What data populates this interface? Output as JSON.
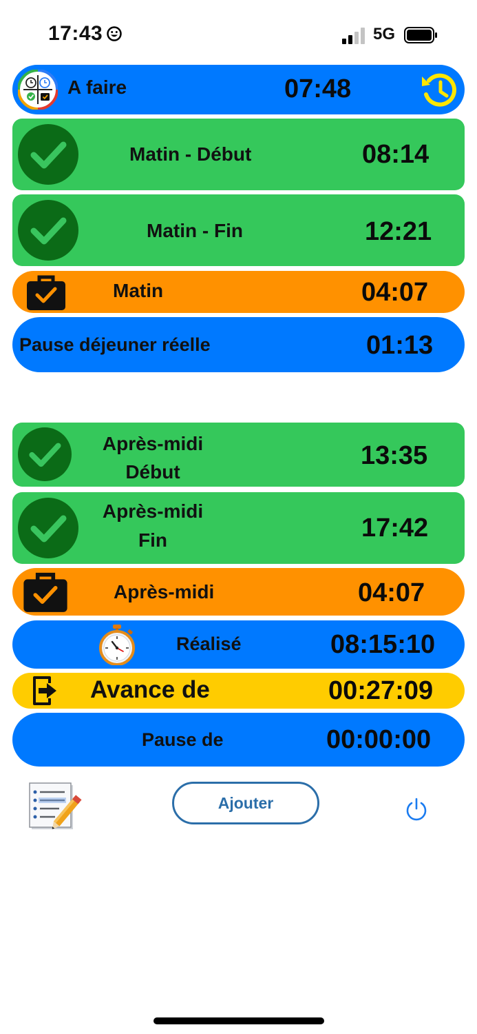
{
  "status": {
    "time": "17:43",
    "network": "5G"
  },
  "header": {
    "title": "A faire",
    "value": "07:48"
  },
  "rows": {
    "matin_debut": {
      "label": "Matin - Début",
      "value": "08:14"
    },
    "matin_fin": {
      "label": "Matin - Fin",
      "value": "12:21"
    },
    "matin": {
      "label": "Matin",
      "value": "04:07"
    },
    "pause_dejeuner": {
      "label": "Pause déjeuner réelle",
      "value": "01:13"
    },
    "apres_midi_debut": {
      "label_line1": "Après-midi",
      "label_line2": "Début",
      "value": "13:35"
    },
    "apres_midi_fin": {
      "label_line1": "Après-midi",
      "label_line2": "Fin",
      "value": "17:42"
    },
    "apres_midi": {
      "label": "Après-midi",
      "value": "04:07"
    },
    "realise": {
      "label": "Réalisé",
      "value": "08:15:10"
    },
    "avance": {
      "label": "Avance de",
      "value": "00:27:09"
    },
    "pause": {
      "label": "Pause de",
      "value": "00:00:00"
    }
  },
  "toolbar": {
    "add_label": "Ajouter"
  },
  "icons": [
    "smiley-icon",
    "signal-icon",
    "battery-icon",
    "app-logo-icon",
    "history-icon",
    "check-icon",
    "briefcase-check-icon",
    "stopwatch-icon",
    "exit-icon",
    "notes-edit-icon",
    "power-icon"
  ],
  "colors": {
    "blue": "#0079ff",
    "green": "#35c85b",
    "dark_green": "#0b6b17",
    "orange": "#ff9100",
    "yellow": "#ffcc00",
    "history_yellow": "#ffe600",
    "button_border": "#2b6ea9"
  }
}
